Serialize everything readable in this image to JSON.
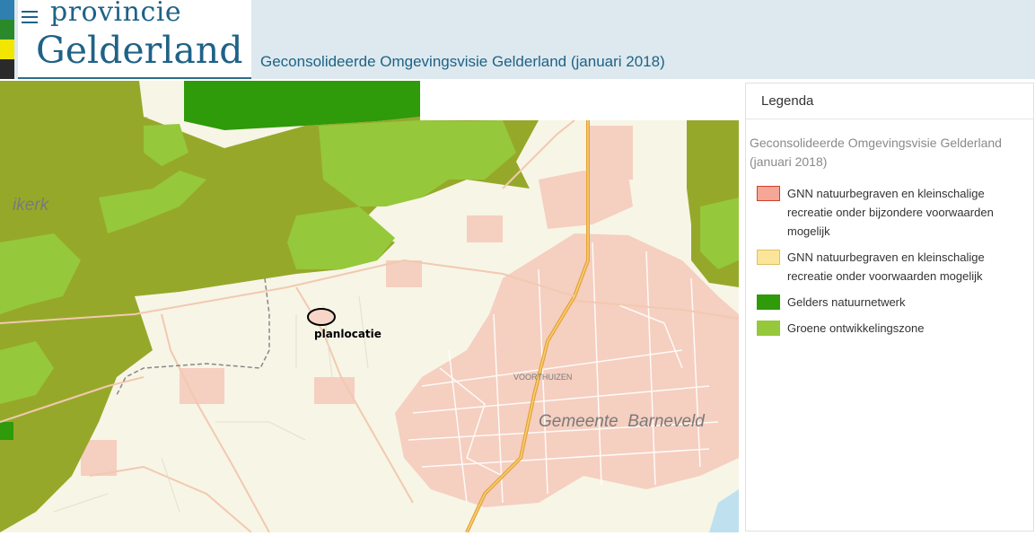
{
  "header": {
    "logo_line1": "provincie",
    "logo_line2": "Gelderland",
    "title": "Geconsolideerde Omgevingsvisie Gelderland (januari 2018)",
    "brand_colors": [
      "#2f7fb0",
      "#2a8a2a",
      "#f2e600",
      "#2a2a2a"
    ]
  },
  "map": {
    "labels": {
      "town_fragment": "ikerk",
      "marker": "planlocatie",
      "village": "VOORTHUIZEN",
      "municipality": "Gemeente  Barneveld"
    }
  },
  "legend": {
    "heading": "Legenda",
    "layer_title": "Geconsolideerde Omgevingsvisie Gelderland (januari 2018)",
    "items": [
      {
        "label": "GNN natuurbegraven en kleinschalige recreatie onder bijzondere voorwaarden mogelijk",
        "fill": "#f4a796",
        "border": "#d0402a"
      },
      {
        "label": "GNN natuurbegraven en kleinschalige recreatie onder voorwaarden mogelijk",
        "fill": "#fbe59a",
        "border": "#e0c060"
      },
      {
        "label": "Gelders natuurnetwerk",
        "fill": "#2f9a0a",
        "border": "#2f9a0a"
      },
      {
        "label": "Groene ontwikkelingszone",
        "fill": "#95c83a",
        "border": "#95c83a"
      }
    ]
  }
}
